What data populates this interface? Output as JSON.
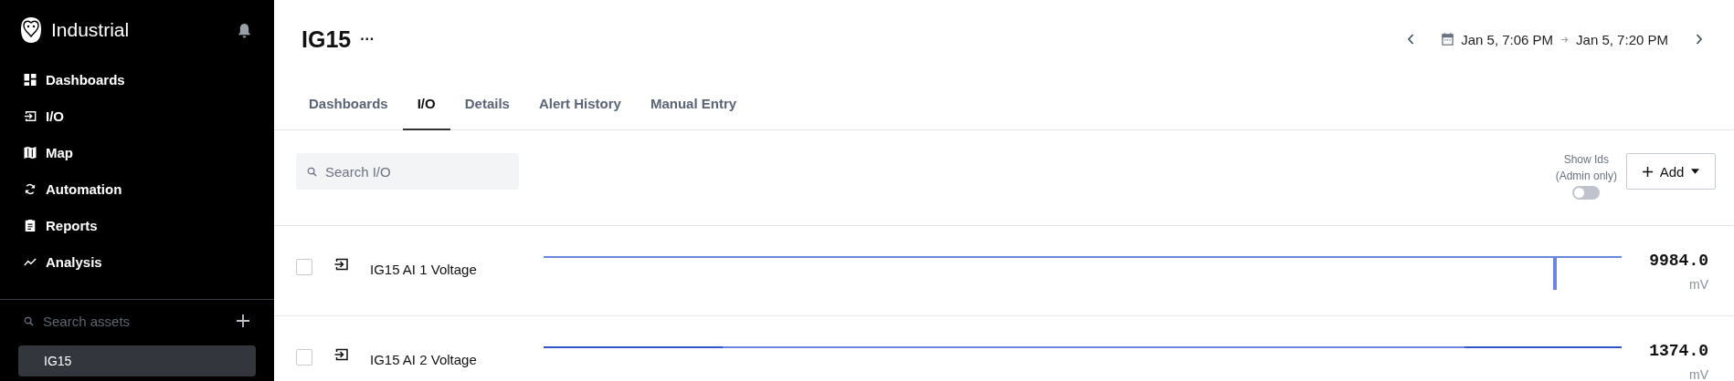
{
  "sidebar": {
    "brand": "Industrial",
    "nav": [
      {
        "label": "Dashboards"
      },
      {
        "label": "I/O"
      },
      {
        "label": "Map"
      },
      {
        "label": "Automation"
      },
      {
        "label": "Reports"
      },
      {
        "label": "Analysis"
      }
    ],
    "search": {
      "placeholder": "Search assets"
    },
    "assets": [
      {
        "label": "IG15",
        "selected": true
      }
    ]
  },
  "header": {
    "title": "IG15",
    "more": "···",
    "range_start": "Jan 5, 7:06 PM",
    "range_end": "Jan 5, 7:20 PM"
  },
  "tabs": [
    {
      "label": "Dashboards",
      "selected": false
    },
    {
      "label": "I/O",
      "selected": true
    },
    {
      "label": "Details",
      "selected": false
    },
    {
      "label": "Alert History",
      "selected": false
    },
    {
      "label": "Manual Entry",
      "selected": false
    }
  ],
  "toolbar": {
    "search": {
      "placeholder": "Search I/O"
    },
    "show_ids": {
      "label": "Show Ids",
      "note": "(Admin only)",
      "on": false
    },
    "add_button": "Add"
  },
  "rows": [
    {
      "name": "IG15 AI 1 Voltage",
      "checked": false,
      "value": "9984.0",
      "unit": "mV"
    },
    {
      "name": "IG15 AI 2 Voltage",
      "checked": false,
      "value": "1374.0",
      "unit": "mV"
    }
  ]
}
